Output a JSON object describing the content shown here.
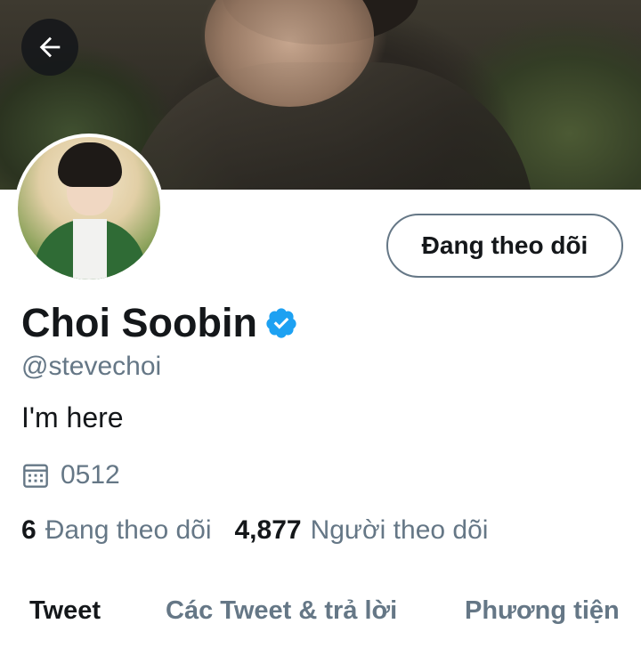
{
  "header": {
    "back_icon": "arrow-left-icon"
  },
  "profile": {
    "follow_button_label": "Đang theo dõi",
    "name": "Choi Soobin",
    "verified_icon": "verified-badge-icon",
    "handle": "@stevechoi",
    "bio": "I'm here",
    "joined_icon": "calendar-icon",
    "joined": "0512"
  },
  "stats": {
    "following_count": "6",
    "following_label": "Đang theo dõi",
    "followers_count": "4,877",
    "followers_label": "Người theo dõi"
  },
  "tabs": [
    {
      "label": "Tweet",
      "active": true
    },
    {
      "label": "Các Tweet & trả lời",
      "active": false
    },
    {
      "label": "Phương tiện",
      "active": false
    }
  ],
  "colors": {
    "primary_text": "#14171a",
    "secondary_text": "#657786",
    "verified_blue": "#1da1f2"
  }
}
